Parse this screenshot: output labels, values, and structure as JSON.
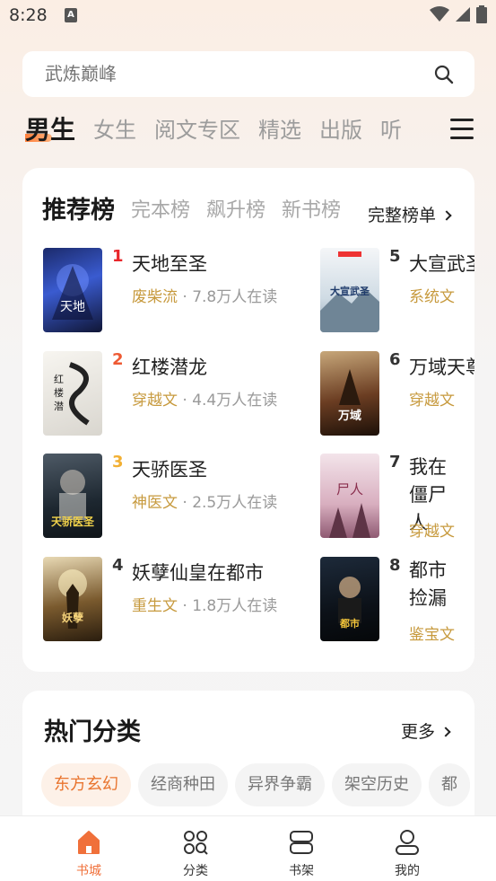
{
  "status": {
    "time": "8:28",
    "notification_icon": "A"
  },
  "search": {
    "placeholder": "武炼巅峰"
  },
  "top_tabs": [
    "男生",
    "女生",
    "阅文专区",
    "精选",
    "出版",
    "听"
  ],
  "rank_card": {
    "tabs": [
      "推荐榜",
      "完本榜",
      "飙升榜",
      "新书榜"
    ],
    "full_list": "完整榜单",
    "books": [
      {
        "rank": "1",
        "title": "天地至圣",
        "genre": "废柴流",
        "readers": " · 7.8万人在读",
        "rank_color": "#e8262a"
      },
      {
        "rank": "2",
        "title": "红楼潜龙",
        "genre": "穿越文",
        "readers": " · 4.4万人在读",
        "rank_color": "#ee5a33"
      },
      {
        "rank": "3",
        "title": "天骄医圣",
        "genre": "神医文",
        "readers": " · 2.5万人在读",
        "rank_color": "#f2b033"
      },
      {
        "rank": "4",
        "title": "妖孽仙皇在都市",
        "genre": "重生文",
        "readers": " · 1.8万人在读",
        "rank_color": "#333333"
      },
      {
        "rank": "5",
        "title": "大宣武圣",
        "genre": "系统文",
        "readers": "",
        "rank_color": "#333333"
      },
      {
        "rank": "6",
        "title": "万域天尊",
        "genre": "穿越文",
        "readers": "",
        "rank_color": "#333333"
      },
      {
        "rank": "7",
        "title": "我在僵尸人",
        "genre": "穿越文",
        "readers": "",
        "rank_color": "#333333"
      },
      {
        "rank": "8",
        "title": "都市捡漏",
        "genre": "鉴宝文",
        "readers": "",
        "rank_color": "#333333"
      }
    ]
  },
  "categories": {
    "title": "热门分类",
    "more": "更多",
    "chips": [
      "东方玄幻",
      "经商种田",
      "异界争霸",
      "架空历史",
      "都"
    ]
  },
  "bottom_nav": [
    {
      "label": "书城",
      "icon": "home-icon"
    },
    {
      "label": "分类",
      "icon": "category-grid-icon"
    },
    {
      "label": "书架",
      "icon": "bookshelf-icon"
    },
    {
      "label": "我的",
      "icon": "profile-icon"
    }
  ],
  "colors": {
    "accent": "#f0703a",
    "genre": "#c79a3e"
  }
}
